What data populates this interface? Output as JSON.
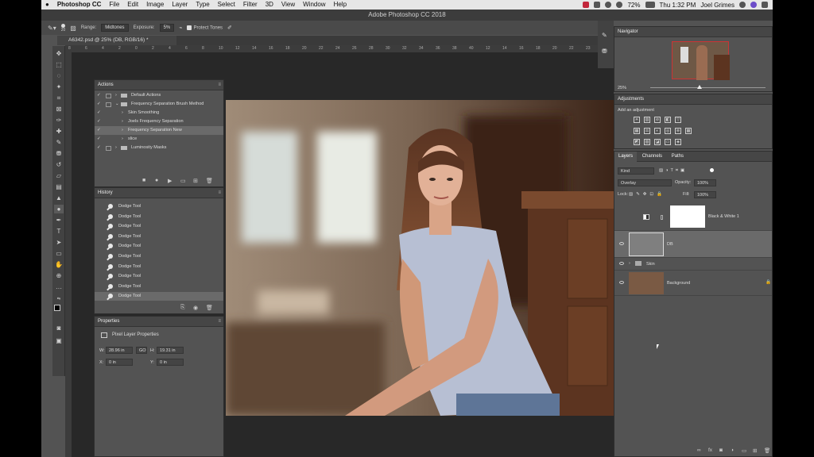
{
  "menubar": {
    "app": "Photoshop CC",
    "items": [
      "File",
      "Edit",
      "Image",
      "Layer",
      "Type",
      "Select",
      "Filter",
      "3D",
      "View",
      "Window",
      "Help"
    ],
    "battery": "72%",
    "clock": "Thu 1:32 PM",
    "user": "Joel Grimes"
  },
  "window": {
    "title": "Adobe Photoshop CC 2018"
  },
  "options": {
    "brush_size": "20",
    "range_label": "Range:",
    "range_value": "Midtones",
    "exposure_label": "Exposure:",
    "exposure_value": "5%",
    "protect_tones": "Protect Tones"
  },
  "document": {
    "tab": "A6342.psd @ 25% (DB, RGB/16) *"
  },
  "ruler": [
    "8",
    "6",
    "4",
    "2",
    "0",
    "2",
    "4",
    "6",
    "8",
    "10",
    "12",
    "14",
    "16",
    "18",
    "20",
    "22",
    "24",
    "26",
    "28",
    "30",
    "32",
    "34",
    "36",
    "38",
    "40",
    "12",
    "14",
    "16",
    "18",
    "20",
    "22",
    "23"
  ],
  "actions": {
    "title": "Actions",
    "items": [
      {
        "label": "Default Actions",
        "indent": 0,
        "folder": true,
        "check": true
      },
      {
        "label": "Frequency Separation Brush Method",
        "indent": 0,
        "folder": true,
        "check": true,
        "open": true
      },
      {
        "label": "Skin Smoothing",
        "indent": 1,
        "folder": false,
        "check": true
      },
      {
        "label": "Joels Frequency Separation",
        "indent": 1,
        "folder": false,
        "check": true
      },
      {
        "label": "Frequency Separation New",
        "indent": 1,
        "folder": false,
        "check": true,
        "selected": true
      },
      {
        "label": "slice",
        "indent": 1,
        "folder": false,
        "check": true
      },
      {
        "label": "Luminosity Masks",
        "indent": 0,
        "folder": true,
        "check": true
      }
    ]
  },
  "history": {
    "title": "History",
    "items": [
      "Dodge Tool",
      "Dodge Tool",
      "Dodge Tool",
      "Dodge Tool",
      "Dodge Tool",
      "Dodge Tool",
      "Dodge Tool",
      "Dodge Tool",
      "Dodge Tool",
      "Dodge Tool"
    ]
  },
  "properties": {
    "title": "Properties",
    "subtitle": "Pixel Layer Properties",
    "w_label": "W:",
    "w_value": "28.96 in",
    "go_label": "GO",
    "h_label": "H:",
    "h_value": "19.31 in",
    "x_label": "X:",
    "x_value": "0 in",
    "y_label": "Y:",
    "y_value": "0 in"
  },
  "navigator": {
    "title": "Navigator",
    "zoom": "25%"
  },
  "adjustments": {
    "title": "Adjustments",
    "subtitle": "Add an adjustment"
  },
  "layers": {
    "tabs": [
      "Layers",
      "Channels",
      "Paths"
    ],
    "kind": "Kind",
    "blend": "Overlay",
    "opacity_label": "Opacity:",
    "opacity": "100%",
    "lock_label": "Lock:",
    "fill_label": "Fill:",
    "fill": "100%",
    "items": [
      {
        "name": "Black & White 1",
        "type": "adjustment"
      },
      {
        "name": "DB",
        "type": "pixel",
        "selected": true
      },
      {
        "name": "Skin",
        "type": "group"
      },
      {
        "name": "Background",
        "type": "background"
      }
    ]
  },
  "colors": {
    "ui_dark": "#535353",
    "panel_head": "#464646",
    "selection": "#6a6a6a"
  }
}
